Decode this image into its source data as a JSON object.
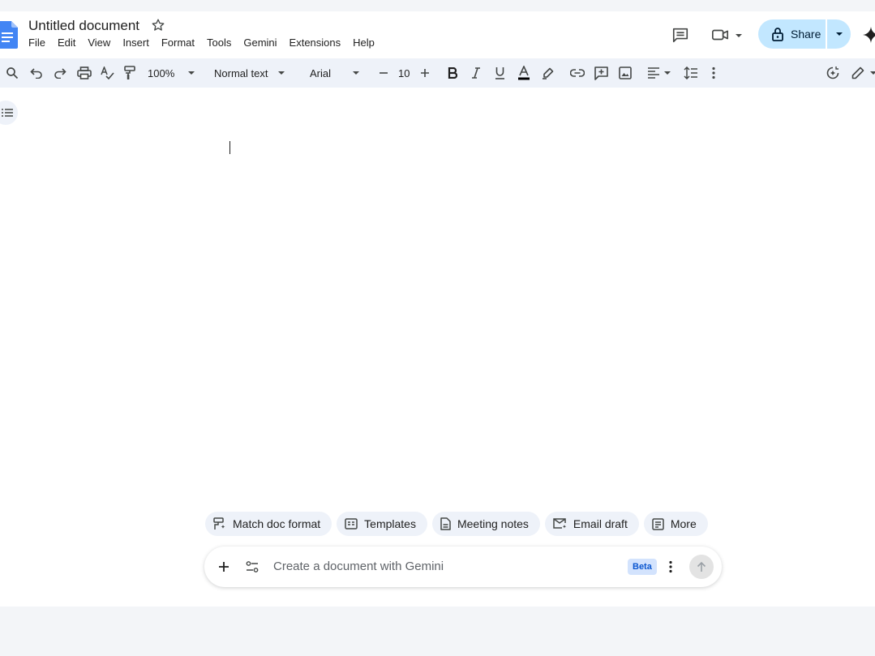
{
  "document": {
    "title": "Untitled document"
  },
  "menu": [
    "File",
    "Edit",
    "View",
    "Insert",
    "Format",
    "Tools",
    "Gemini",
    "Extensions",
    "Help"
  ],
  "header": {
    "share_label": "Share"
  },
  "toolbar": {
    "zoom": "100%",
    "style": "Normal text",
    "font": "Arial",
    "font_size": "10"
  },
  "gemini": {
    "chips": [
      "Match doc format",
      "Templates",
      "Meeting notes",
      "Email draft",
      "More"
    ],
    "placeholder": "Create a document with Gemini",
    "beta_label": "Beta"
  },
  "icons": {
    "doc": "docs-logo-icon",
    "star": "star-icon",
    "comments": "comments-icon",
    "meet": "video-call-icon",
    "gemini": "gemini-sparkle-icon"
  },
  "colors": {
    "accent": "#c2e7ff",
    "toolbar_bg": "#eef2f9",
    "docs_blue": "#4285f4"
  }
}
